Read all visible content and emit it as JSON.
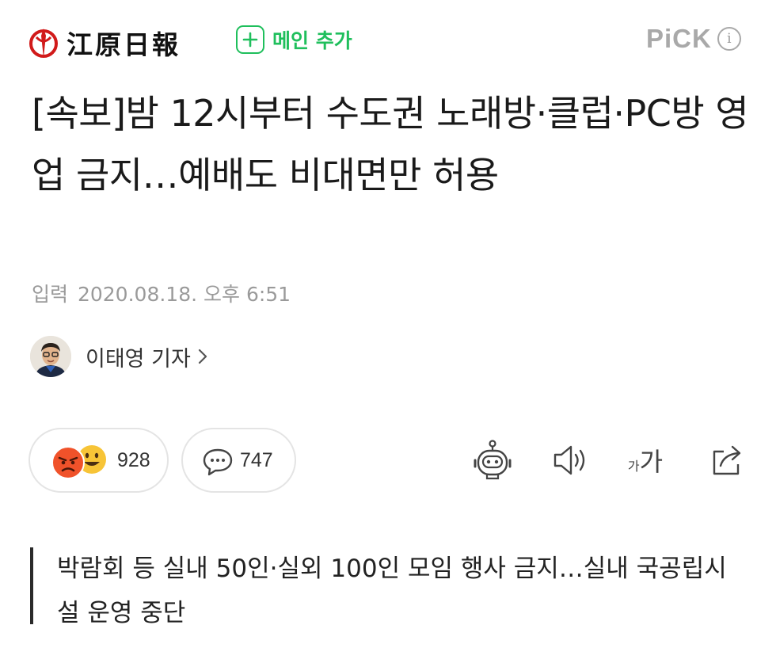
{
  "header": {
    "logo_text": "江原日報",
    "subscribe_label": "메인 추가",
    "pick_label": "PiCK",
    "info_glyph": "i"
  },
  "article": {
    "headline": "[속보]밤 12시부터 수도권 노래방·클럽·PC방 영업 금지…예배도 비대면만 허용",
    "date_label": "입력",
    "date_value": "2020.08.18. 오후 6:51",
    "reporter_name": "이태영 기자",
    "subtitle": "박람회 등 실내 50인·실외 100인 모임 행사 금지…실내 국공립시설 운영 중단"
  },
  "actions": {
    "reaction_count": "928",
    "comment_count": "747",
    "font_size_small": "가",
    "font_size_big": "가",
    "icons": [
      "summary-bot-icon",
      "speaker-icon",
      "font-size-icon",
      "share-icon"
    ]
  },
  "colors": {
    "accent_green": "#1fbf5c",
    "logo_red": "#d11a1a",
    "muted_gray": "#9a9a9a"
  }
}
